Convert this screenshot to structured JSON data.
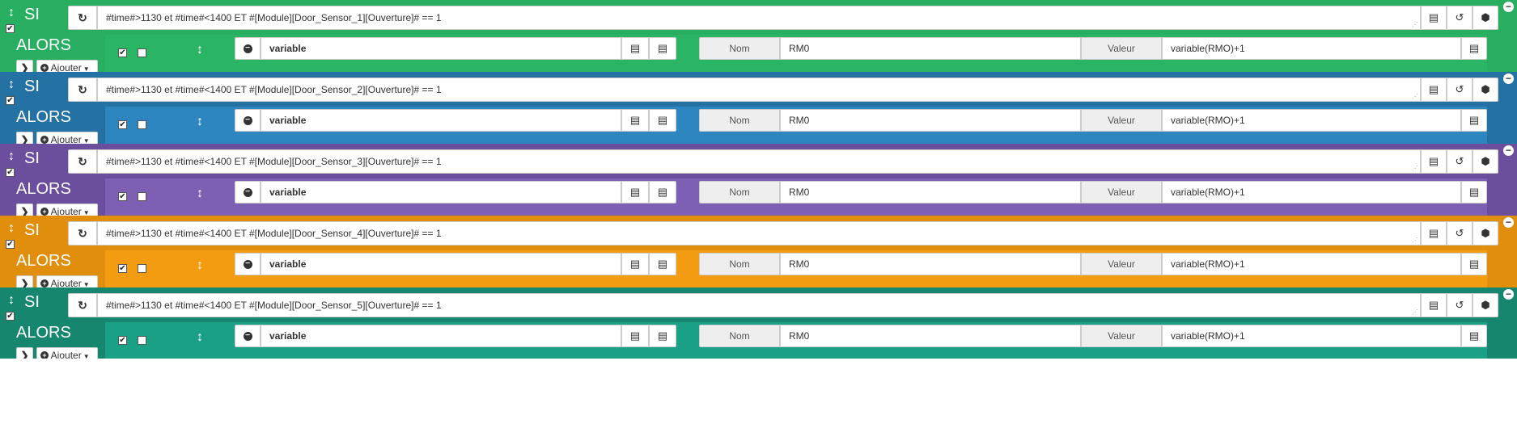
{
  "labels": {
    "si": "SI",
    "alors": "ALORS",
    "ajouter": "Ajouter",
    "nom": "Nom",
    "valeur": "Valeur"
  },
  "icons": {
    "drag": "drag-handle-icon",
    "refresh": "refresh-icon",
    "list": "list-icon",
    "history": "history-icon",
    "cube": "cube-icon",
    "remove": "minus-circle-icon",
    "expand": "chevron-right-icon",
    "add": "plus-circle-icon",
    "caret": "caret-down-icon"
  },
  "blocks": [
    {
      "color": "#27ae60",
      "inner_color": "#2ab565",
      "condition": "#time#>1130 et #time#<1400 ET #[Module][Door_Sensor_1][Ouverture]# == 1",
      "si_checked": true,
      "action": {
        "enabled": true,
        "second_checked": false,
        "expression": "variable",
        "nom": "RM0",
        "valeur": "variable(RMO)+1"
      }
    },
    {
      "color": "#2472a4",
      "inner_color": "#2e86c1",
      "condition": "#time#>1130 et #time#<1400 ET #[Module][Door_Sensor_2][Ouverture]# == 1",
      "si_checked": true,
      "action": {
        "enabled": true,
        "second_checked": false,
        "expression": "variable",
        "nom": "RM0",
        "valeur": "variable(RMO)+1"
      }
    },
    {
      "color": "#6b4f9e",
      "inner_color": "#7d5fb4",
      "condition": "#time#>1130 et #time#<1400 ET #[Module][Door_Sensor_3][Ouverture]# == 1",
      "si_checked": true,
      "action": {
        "enabled": true,
        "second_checked": false,
        "expression": "variable",
        "nom": "RM0",
        "valeur": "variable(RMO)+1"
      }
    },
    {
      "color": "#e08e0b",
      "inner_color": "#f39c12",
      "condition": "#time#>1130 et #time#<1400 ET #[Module][Door_Sensor_4][Ouverture]# == 1",
      "si_checked": true,
      "action": {
        "enabled": true,
        "second_checked": false,
        "expression": "variable",
        "nom": "RM0",
        "valeur": "variable(RMO)+1"
      }
    },
    {
      "color": "#16866f",
      "inner_color": "#1aa084",
      "condition": "#time#>1130 et #time#<1400 ET #[Module][Door_Sensor_5][Ouverture]# == 1",
      "si_checked": true,
      "action": {
        "enabled": true,
        "second_checked": false,
        "expression": "variable",
        "nom": "RM0",
        "valeur": "variable(RMO)+1"
      }
    }
  ]
}
